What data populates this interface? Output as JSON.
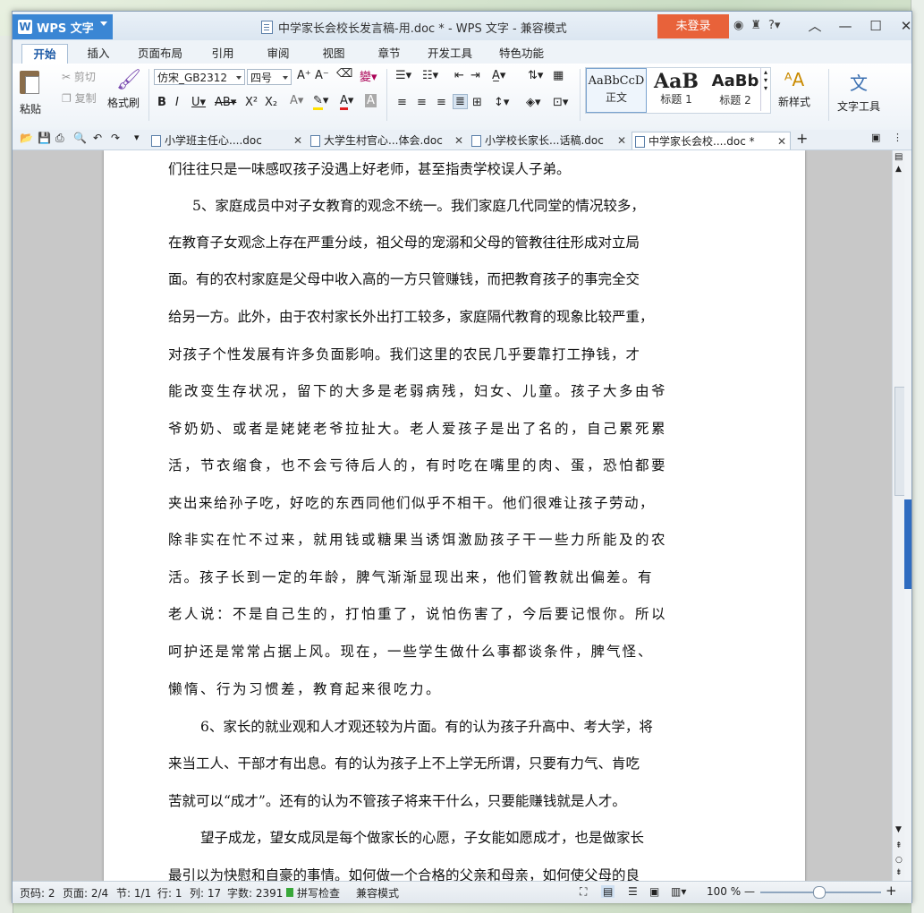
{
  "app": {
    "logo_text": "WPS 文字",
    "window_title": "中学家长会校长发言稿-用.doc * - WPS 文字 - 兼容模式",
    "login_label": "未登录"
  },
  "menu_tabs": [
    "开始",
    "插入",
    "页面布局",
    "引用",
    "审阅",
    "视图",
    "章节",
    "开发工具",
    "特色功能"
  ],
  "ribbon": {
    "paste": "粘贴",
    "cut": "剪切",
    "copy": "复制",
    "format_painter": "格式刷",
    "font_name": "仿宋_GB2312",
    "font_size": "四号",
    "styles": [
      {
        "preview": "AaBbCcD",
        "label": "正文"
      },
      {
        "preview": "AaB",
        "label": "标题 1"
      },
      {
        "preview": "AaBb",
        "label": "标题 2"
      }
    ],
    "new_style": "新样式",
    "text_tools": "文字工具"
  },
  "doc_tabs": [
    {
      "label": "小学班主任心....doc",
      "active": false
    },
    {
      "label": "大学生村官心...体会.doc",
      "active": false
    },
    {
      "label": "小学校长家长...话稿.doc",
      "active": false
    },
    {
      "label": "中学家长会校....doc *",
      "active": true
    }
  ],
  "document": {
    "lines": [
      "们往往只是一味感叹孩子没遇上好老师，甚至指责学校误人子弟。",
      "5、家庭成员中对子女教育的观念不统一。我们家庭几代同堂的情况较多，",
      "在教育子女观念上存在严重分歧，祖父母的宠溺和父母的管教往往形成对立局",
      "面。有的农村家庭是父母中收入高的一方只管赚钱，而把教育孩子的事完全交",
      "给另一方。此外，由于农村家长外出打工较多，家庭隔代教育的现象比较严重，",
      "对孩子个性发展有许多负面影响。我们这里的农民几乎要靠打工挣钱，才",
      "能改变生存状况，留下的大多是老弱病残，妇女、儿童。孩子大多由爷",
      "爷奶奶、或者是姥姥老爷拉扯大。老人爱孩子是出了名的，自己累死累",
      "活，节衣缩食，也不会亏待后人的，有时吃在嘴里的肉、蛋，恐怕都要",
      "夹出来给孙子吃，好吃的东西同他们似乎不相干。他们很难让孩子劳动，",
      "除非实在忙不过来，就用钱或糖果当诱饵激励孩子干一些力所能及的农",
      "活。孩子长到一定的年龄，脾气渐渐显现出来，他们管教就出偏差。有",
      "老人说：不是自己生的，打怕重了，说怕伤害了，今后要记恨你。所以",
      "呵护还是常常占据上风。现在，一些学生做什么事都谈条件，脾气怪、",
      "懒惰、行为习惯差，教育起来很吃力。",
      "6、家长的就业观和人才观还较为片面。有的认为孩子升高中、考大学，将",
      "来当工人、干部才有出息。有的认为孩子上不上学无所谓，只要有力气、肯吃",
      "苦就可以“成才”。还有的认为不管孩子将来干什么，只要能赚钱就是人才。",
      "望子成龙，望女成凤是每个做家长的心愿，子女能如愿成才，也是做家长",
      "最引以为快慰和自豪的事情。如何做一个合格的父亲和母亲，如何使父母的良"
    ]
  },
  "status": {
    "page": "页码: 2",
    "pages": "页面: 2/4",
    "section": "节: 1/1",
    "row": "行: 1",
    "col": "列: 17",
    "wordcount": "字数: 2391",
    "spellcheck": "拼写检查",
    "compat": "兼容模式",
    "zoom": "100 %"
  },
  "colors": {
    "accent": "#3a86d4",
    "login": "#e8623a"
  }
}
